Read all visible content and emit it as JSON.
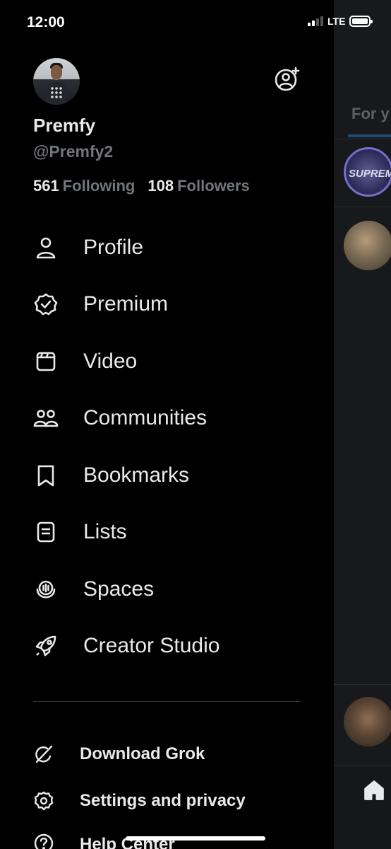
{
  "status_bar": {
    "time": "12:00",
    "network": "LTE"
  },
  "profile": {
    "display_name": "Premfy",
    "handle": "@Premfy2",
    "following_count": "561",
    "following_label": "Following",
    "followers_count": "108",
    "followers_label": "Followers"
  },
  "menu": [
    {
      "label": "Profile",
      "icon": "person-icon"
    },
    {
      "label": "Premium",
      "icon": "verified-badge-icon"
    },
    {
      "label": "Video",
      "icon": "video-icon"
    },
    {
      "label": "Communities",
      "icon": "communities-icon"
    },
    {
      "label": "Bookmarks",
      "icon": "bookmark-icon"
    },
    {
      "label": "Lists",
      "icon": "list-icon"
    },
    {
      "label": "Spaces",
      "icon": "spaces-icon"
    },
    {
      "label": "Creator Studio",
      "icon": "rocket-icon"
    }
  ],
  "secondary": [
    {
      "label": "Download Grok",
      "icon": "grok-icon"
    },
    {
      "label": "Settings and privacy",
      "icon": "gear-icon"
    },
    {
      "label": "Help Center",
      "icon": "help-icon"
    }
  ],
  "background_peek": {
    "tab_label": "For y",
    "avatar_text": "SUPREM"
  },
  "colors": {
    "background": "#000000",
    "text": "#e7e9ea",
    "muted": "#71767b",
    "peek": "#17191c"
  }
}
